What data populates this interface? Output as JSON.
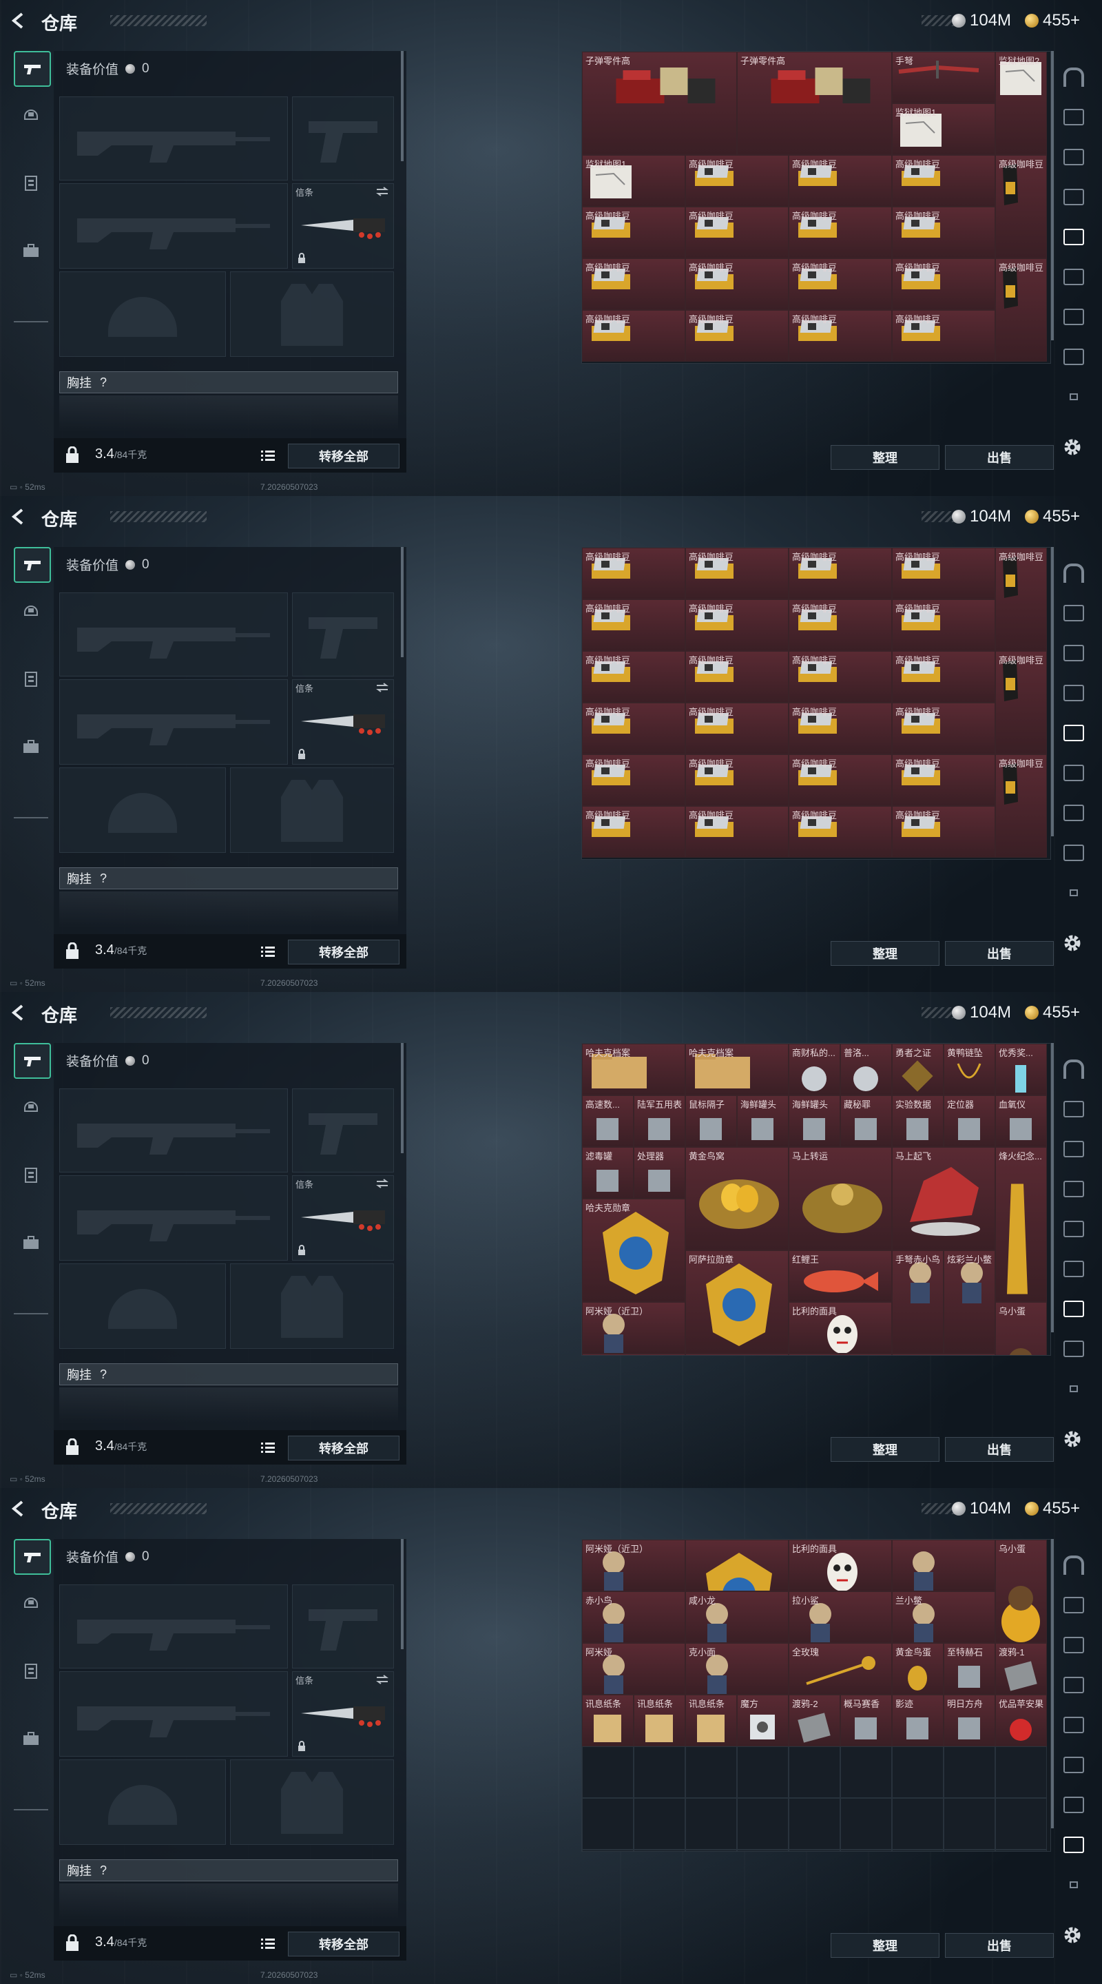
{
  "title": "仓库",
  "currency": {
    "silver": "104M",
    "gold": "455+"
  },
  "equip_value_label": "装备价值",
  "equip_value": "0",
  "melee_label": "信条",
  "chest_label": "胸挂",
  "chest_help": "?",
  "weight_value": "3.4",
  "weight_capacity": "/84千克",
  "transfer_all_label": "转移全部",
  "sort_label": "整理",
  "sell_label": "出售",
  "status_ping": "52ms",
  "build_number": "7.20260507023",
  "colors": {
    "accent": "#3fbf9a",
    "item_bg": "#5a2a33",
    "gold": "#d9a62b"
  },
  "screens": [
    {
      "items": [
        {
          "c": 0,
          "r": 0,
          "w": 3,
          "h": 2,
          "name": "子弹零件高",
          "icon": "ammo-parts-icon"
        },
        {
          "c": 3,
          "r": 0,
          "w": 3,
          "h": 2,
          "name": "子弹零件高",
          "icon": "ammo-parts-icon"
        },
        {
          "c": 6,
          "r": 0,
          "w": 2,
          "h": 1,
          "name": "手弩",
          "icon": "crossbow-icon"
        },
        {
          "c": 8,
          "r": 0,
          "w": 1,
          "h": 2,
          "name": "监狱地图2",
          "icon": "map-icon"
        },
        {
          "c": 6,
          "r": 1,
          "w": 2,
          "h": 1,
          "name": "监狱地图1",
          "icon": "map-icon"
        },
        {
          "c": 0,
          "r": 2,
          "w": 2,
          "h": 1,
          "name": "监狱地图1",
          "icon": "map-icon"
        },
        {
          "c": 2,
          "r": 2,
          "w": 2,
          "h": 1,
          "name": "高级咖啡豆",
          "icon": "coffee-box-icon"
        },
        {
          "c": 4,
          "r": 2,
          "w": 2,
          "h": 1,
          "name": "高级咖啡豆",
          "icon": "coffee-box-icon"
        },
        {
          "c": 6,
          "r": 2,
          "w": 2,
          "h": 1,
          "name": "高级咖啡豆",
          "icon": "coffee-box-icon"
        },
        {
          "c": 8,
          "r": 2,
          "w": 1,
          "h": 2,
          "name": "高级咖啡豆",
          "icon": "coffee-bag-icon"
        },
        {
          "c": 0,
          "r": 3,
          "w": 2,
          "h": 1,
          "name": "高级咖啡豆",
          "icon": "coffee-box-icon"
        },
        {
          "c": 2,
          "r": 3,
          "w": 2,
          "h": 1,
          "name": "高级咖啡豆",
          "icon": "coffee-box-icon"
        },
        {
          "c": 4,
          "r": 3,
          "w": 2,
          "h": 1,
          "name": "高级咖啡豆",
          "icon": "coffee-box-icon"
        },
        {
          "c": 6,
          "r": 3,
          "w": 2,
          "h": 1,
          "name": "高级咖啡豆",
          "icon": "coffee-box-icon"
        },
        {
          "c": 0,
          "r": 4,
          "w": 2,
          "h": 1,
          "name": "高级咖啡豆",
          "icon": "coffee-box-icon"
        },
        {
          "c": 2,
          "r": 4,
          "w": 2,
          "h": 1,
          "name": "高级咖啡豆",
          "icon": "coffee-box-icon"
        },
        {
          "c": 4,
          "r": 4,
          "w": 2,
          "h": 1,
          "name": "高级咖啡豆",
          "icon": "coffee-box-icon"
        },
        {
          "c": 6,
          "r": 4,
          "w": 2,
          "h": 1,
          "name": "高级咖啡豆",
          "icon": "coffee-box-icon"
        },
        {
          "c": 8,
          "r": 4,
          "w": 1,
          "h": 2,
          "name": "高级咖啡豆",
          "icon": "coffee-bag-icon"
        },
        {
          "c": 0,
          "r": 5,
          "w": 2,
          "h": 1,
          "name": "高级咖啡豆",
          "icon": "coffee-box-icon"
        },
        {
          "c": 2,
          "r": 5,
          "w": 2,
          "h": 1,
          "name": "高级咖啡豆",
          "icon": "coffee-box-icon"
        },
        {
          "c": 4,
          "r": 5,
          "w": 2,
          "h": 1,
          "name": "高级咖啡豆",
          "icon": "coffee-box-icon"
        },
        {
          "c": 6,
          "r": 5,
          "w": 2,
          "h": 1,
          "name": "高级咖啡豆",
          "icon": "coffee-box-icon"
        }
      ],
      "empty_rows": []
    },
    {
      "items": [
        {
          "c": 0,
          "r": 0,
          "w": 2,
          "h": 1,
          "name": "高级咖啡豆",
          "icon": "coffee-box-icon"
        },
        {
          "c": 2,
          "r": 0,
          "w": 2,
          "h": 1,
          "name": "高级咖啡豆",
          "icon": "coffee-box-icon"
        },
        {
          "c": 4,
          "r": 0,
          "w": 2,
          "h": 1,
          "name": "高级咖啡豆",
          "icon": "coffee-box-icon"
        },
        {
          "c": 6,
          "r": 0,
          "w": 2,
          "h": 1,
          "name": "高级咖啡豆",
          "icon": "coffee-box-icon"
        },
        {
          "c": 8,
          "r": 0,
          "w": 1,
          "h": 2,
          "name": "高级咖啡豆",
          "icon": "coffee-bag-icon"
        },
        {
          "c": 0,
          "r": 1,
          "w": 2,
          "h": 1,
          "name": "高级咖啡豆",
          "icon": "coffee-box-icon"
        },
        {
          "c": 2,
          "r": 1,
          "w": 2,
          "h": 1,
          "name": "高级咖啡豆",
          "icon": "coffee-box-icon"
        },
        {
          "c": 4,
          "r": 1,
          "w": 2,
          "h": 1,
          "name": "高级咖啡豆",
          "icon": "coffee-box-icon"
        },
        {
          "c": 6,
          "r": 1,
          "w": 2,
          "h": 1,
          "name": "高级咖啡豆",
          "icon": "coffee-box-icon"
        },
        {
          "c": 0,
          "r": 2,
          "w": 2,
          "h": 1,
          "name": "高级咖啡豆",
          "icon": "coffee-box-icon"
        },
        {
          "c": 2,
          "r": 2,
          "w": 2,
          "h": 1,
          "name": "高级咖啡豆",
          "icon": "coffee-box-icon"
        },
        {
          "c": 4,
          "r": 2,
          "w": 2,
          "h": 1,
          "name": "高级咖啡豆",
          "icon": "coffee-box-icon"
        },
        {
          "c": 6,
          "r": 2,
          "w": 2,
          "h": 1,
          "name": "高级咖啡豆",
          "icon": "coffee-box-icon"
        },
        {
          "c": 8,
          "r": 2,
          "w": 1,
          "h": 2,
          "name": "高级咖啡豆",
          "icon": "coffee-bag-icon"
        },
        {
          "c": 0,
          "r": 3,
          "w": 2,
          "h": 1,
          "name": "高级咖啡豆",
          "icon": "coffee-box-icon"
        },
        {
          "c": 2,
          "r": 3,
          "w": 2,
          "h": 1,
          "name": "高级咖啡豆",
          "icon": "coffee-box-icon"
        },
        {
          "c": 4,
          "r": 3,
          "w": 2,
          "h": 1,
          "name": "高级咖啡豆",
          "icon": "coffee-box-icon"
        },
        {
          "c": 6,
          "r": 3,
          "w": 2,
          "h": 1,
          "name": "高级咖啡豆",
          "icon": "coffee-box-icon"
        },
        {
          "c": 0,
          "r": 4,
          "w": 2,
          "h": 1,
          "name": "高级咖啡豆",
          "icon": "coffee-box-icon"
        },
        {
          "c": 2,
          "r": 4,
          "w": 2,
          "h": 1,
          "name": "高级咖啡豆",
          "icon": "coffee-box-icon"
        },
        {
          "c": 4,
          "r": 4,
          "w": 2,
          "h": 1,
          "name": "高级咖啡豆",
          "icon": "coffee-box-icon"
        },
        {
          "c": 6,
          "r": 4,
          "w": 2,
          "h": 1,
          "name": "高级咖啡豆",
          "icon": "coffee-box-icon"
        },
        {
          "c": 8,
          "r": 4,
          "w": 1,
          "h": 2,
          "name": "高级咖啡豆",
          "icon": "coffee-bag-icon"
        },
        {
          "c": 0,
          "r": 5,
          "w": 2,
          "h": 1,
          "name": "高级咖啡豆",
          "icon": "coffee-box-icon"
        },
        {
          "c": 2,
          "r": 5,
          "w": 2,
          "h": 1,
          "name": "高级咖啡豆",
          "icon": "coffee-box-icon"
        },
        {
          "c": 4,
          "r": 5,
          "w": 2,
          "h": 1,
          "name": "高级咖啡豆",
          "icon": "coffee-box-icon"
        },
        {
          "c": 6,
          "r": 5,
          "w": 2,
          "h": 1,
          "name": "高级咖啡豆",
          "icon": "coffee-box-icon"
        }
      ],
      "empty_rows": []
    },
    {
      "items": [
        {
          "c": 0,
          "r": 0,
          "w": 2,
          "h": 1,
          "name": "哈夫克档案",
          "icon": "folder-icon"
        },
        {
          "c": 2,
          "r": 0,
          "w": 2,
          "h": 1,
          "name": "哈夫克档案",
          "icon": "folder-icon"
        },
        {
          "c": 4,
          "r": 0,
          "w": 1,
          "h": 1,
          "name": "商财私的...",
          "icon": "silver-orb-icon"
        },
        {
          "c": 5,
          "r": 0,
          "w": 1,
          "h": 1,
          "name": "普洛...",
          "icon": "crystal-icon"
        },
        {
          "c": 6,
          "r": 0,
          "w": 1,
          "h": 1,
          "name": "勇者之证",
          "icon": "badge-icon"
        },
        {
          "c": 7,
          "r": 0,
          "w": 1,
          "h": 1,
          "name": "黄鸭链坠",
          "icon": "necklace-icon"
        },
        {
          "c": 8,
          "r": 0,
          "w": 1,
          "h": 1,
          "name": "优秀奖...",
          "icon": "trophy-icon"
        },
        {
          "c": 0,
          "r": 1,
          "w": 1,
          "h": 1,
          "name": "高速数...",
          "icon": "drive-icon"
        },
        {
          "c": 1,
          "r": 1,
          "w": 1,
          "h": 1,
          "name": "陆军五用表",
          "icon": "watch-icon"
        },
        {
          "c": 2,
          "r": 1,
          "w": 1,
          "h": 1,
          "name": "鼠标隔子",
          "icon": "mouse-icon"
        },
        {
          "c": 3,
          "r": 1,
          "w": 1,
          "h": 1,
          "name": "海鲜罐头",
          "icon": "can-icon"
        },
        {
          "c": 4,
          "r": 1,
          "w": 1,
          "h": 1,
          "name": "海鲜罐头",
          "icon": "can-icon"
        },
        {
          "c": 5,
          "r": 1,
          "w": 1,
          "h": 1,
          "name": "藏秘罪",
          "icon": "scroll-icon"
        },
        {
          "c": 6,
          "r": 1,
          "w": 1,
          "h": 1,
          "name": "实验数据",
          "icon": "whistle-icon"
        },
        {
          "c": 7,
          "r": 1,
          "w": 1,
          "h": 1,
          "name": "定位器",
          "icon": "tag-icon"
        },
        {
          "c": 8,
          "r": 1,
          "w": 1,
          "h": 1,
          "name": "血氧仪",
          "icon": "oximeter-icon"
        },
        {
          "c": 0,
          "r": 2,
          "w": 1,
          "h": 1,
          "name": "滤毒罐",
          "icon": "filter-icon"
        },
        {
          "c": 1,
          "r": 2,
          "w": 1,
          "h": 1,
          "name": "处理器",
          "icon": "chip-icon"
        },
        {
          "c": 2,
          "r": 2,
          "w": 2,
          "h": 2,
          "name": "黄金鸟窝",
          "icon": "golden-nest-icon"
        },
        {
          "c": 4,
          "r": 2,
          "w": 2,
          "h": 2,
          "name": "马上转运",
          "icon": "compass-icon"
        },
        {
          "c": 6,
          "r": 2,
          "w": 2,
          "h": 2,
          "name": "马上起飞",
          "icon": "horse-icon"
        },
        {
          "c": 8,
          "r": 2,
          "w": 1,
          "h": 3,
          "name": "烽火纪念...",
          "icon": "tower-icon"
        },
        {
          "c": 0,
          "r": 3,
          "w": 2,
          "h": 2,
          "name": "哈夫克勋章",
          "icon": "medal-icon"
        },
        {
          "c": 2,
          "r": 4,
          "w": 2,
          "h": 2,
          "name": "阿萨拉勋章",
          "icon": "medal-icon"
        },
        {
          "c": 4,
          "r": 4,
          "w": 2,
          "h": 1,
          "name": "红鲤王",
          "icon": "fish-icon"
        },
        {
          "c": 6,
          "r": 4,
          "w": 1,
          "h": 2,
          "name": "手弩赤小鸟",
          "icon": "figure-icon"
        },
        {
          "c": 7,
          "r": 4,
          "w": 1,
          "h": 2,
          "name": "炫彩兰小鳖",
          "icon": "figure-icon"
        },
        {
          "c": 0,
          "r": 5,
          "w": 2,
          "h": 1,
          "name": "阿米娅（近卫）",
          "icon": "figure-icon"
        },
        {
          "c": 4,
          "r": 5,
          "w": 2,
          "h": 1,
          "name": "比利的面具",
          "icon": "mask-icon"
        },
        {
          "c": 8,
          "r": 5,
          "w": 1,
          "h": 2,
          "name": "乌小蛋",
          "icon": "egg-icon"
        },
        {
          "c": 0,
          "r": 6,
          "w": 2,
          "h": 1,
          "name": "赤小鸟",
          "icon": "figure-icon"
        },
        {
          "c": 2,
          "r": 6,
          "w": 2,
          "h": 1,
          "name": "咸小龙",
          "icon": "figure-icon"
        },
        {
          "c": 4,
          "r": 6,
          "w": 2,
          "h": 1,
          "name": "拉小鲨",
          "icon": "figure-icon"
        },
        {
          "c": 6,
          "r": 6,
          "w": 2,
          "h": 1,
          "name": "兰小鳖",
          "icon": "figure-icon"
        },
        {
          "c": 0,
          "r": 7,
          "w": 2,
          "h": 1,
          "name": "阿米娅",
          "icon": "figure-icon"
        },
        {
          "c": 2,
          "r": 7,
          "w": 2,
          "h": 1,
          "name": "克小面",
          "icon": "figure-icon"
        },
        {
          "c": 4,
          "r": 7,
          "w": 2,
          "h": 1,
          "name": "全玫瑰",
          "icon": "rose-icon"
        },
        {
          "c": 6,
          "r": 7,
          "w": 1,
          "h": 1,
          "name": "黄金鸟蛋",
          "icon": "golden-egg-icon"
        },
        {
          "c": 7,
          "r": 7,
          "w": 1,
          "h": 1,
          "name": "至特赫石",
          "icon": "stone-icon"
        },
        {
          "c": 8,
          "r": 7,
          "w": 1,
          "h": 1,
          "name": "渡鸦-1",
          "icon": "card-icon"
        }
      ],
      "empty_rows": []
    },
    {
      "items": [
        {
          "c": 0,
          "r": 0,
          "w": 2,
          "h": 1,
          "name": "阿米娅（近卫）",
          "icon": "figure-icon"
        },
        {
          "c": 2,
          "r": 0,
          "w": 2,
          "h": 1,
          "name": "",
          "icon": "medal-icon"
        },
        {
          "c": 4,
          "r": 0,
          "w": 2,
          "h": 1,
          "name": "比利的面具",
          "icon": "mask-icon"
        },
        {
          "c": 6,
          "r": 0,
          "w": 2,
          "h": 1,
          "name": "",
          "icon": "figure-icon"
        },
        {
          "c": 8,
          "r": 0,
          "w": 1,
          "h": 2,
          "name": "乌小蛋",
          "icon": "egg-icon"
        },
        {
          "c": 0,
          "r": 1,
          "w": 2,
          "h": 1,
          "name": "赤小鸟",
          "icon": "figure-icon"
        },
        {
          "c": 2,
          "r": 1,
          "w": 2,
          "h": 1,
          "name": "咸小龙",
          "icon": "figure-icon"
        },
        {
          "c": 4,
          "r": 1,
          "w": 2,
          "h": 1,
          "name": "拉小鲨",
          "icon": "figure-icon"
        },
        {
          "c": 6,
          "r": 1,
          "w": 2,
          "h": 1,
          "name": "兰小鳖",
          "icon": "figure-icon"
        },
        {
          "c": 0,
          "r": 2,
          "w": 2,
          "h": 1,
          "name": "阿米娅",
          "icon": "figure-icon"
        },
        {
          "c": 2,
          "r": 2,
          "w": 2,
          "h": 1,
          "name": "克小面",
          "icon": "figure-icon"
        },
        {
          "c": 4,
          "r": 2,
          "w": 2,
          "h": 1,
          "name": "全玫瑰",
          "icon": "rose-icon"
        },
        {
          "c": 6,
          "r": 2,
          "w": 1,
          "h": 1,
          "name": "黄金鸟蛋",
          "icon": "golden-egg-icon"
        },
        {
          "c": 7,
          "r": 2,
          "w": 1,
          "h": 1,
          "name": "至特赫石",
          "icon": "stone-icon"
        },
        {
          "c": 8,
          "r": 2,
          "w": 1,
          "h": 1,
          "name": "渡鸦-1",
          "icon": "card-icon"
        },
        {
          "c": 0,
          "r": 3,
          "w": 1,
          "h": 1,
          "name": "讯息纸条",
          "icon": "note-icon"
        },
        {
          "c": 1,
          "r": 3,
          "w": 1,
          "h": 1,
          "name": "讯息纸条",
          "icon": "note-icon"
        },
        {
          "c": 2,
          "r": 3,
          "w": 1,
          "h": 1,
          "name": "讯息纸条",
          "icon": "note-icon"
        },
        {
          "c": 3,
          "r": 3,
          "w": 1,
          "h": 1,
          "name": "魔方",
          "icon": "cube-icon"
        },
        {
          "c": 4,
          "r": 3,
          "w": 1,
          "h": 1,
          "name": "渡鸦-2",
          "icon": "card-icon"
        },
        {
          "c": 5,
          "r": 3,
          "w": 1,
          "h": 1,
          "name": "概马赛香",
          "icon": "incense-icon"
        },
        {
          "c": 6,
          "r": 3,
          "w": 1,
          "h": 1,
          "name": "影迹",
          "icon": "shard-icon"
        },
        {
          "c": 7,
          "r": 3,
          "w": 1,
          "h": 1,
          "name": "明日方舟",
          "icon": "cd-icon"
        },
        {
          "c": 8,
          "r": 3,
          "w": 1,
          "h": 1,
          "name": "优品苹安果",
          "icon": "apple-icon"
        }
      ],
      "empty_rows": [
        4,
        5,
        6,
        7,
        8,
        9
      ]
    }
  ],
  "right_tabs": [
    "base-icon",
    "tab-I-icon",
    "tab-II-icon",
    "tab-III-icon",
    "tab-IV-icon",
    "tab-V-icon",
    "tab-VI-icon",
    "tab-VII-icon",
    "small-lock-icon"
  ],
  "right_tab_active_index": [
    4,
    4,
    6,
    7
  ]
}
